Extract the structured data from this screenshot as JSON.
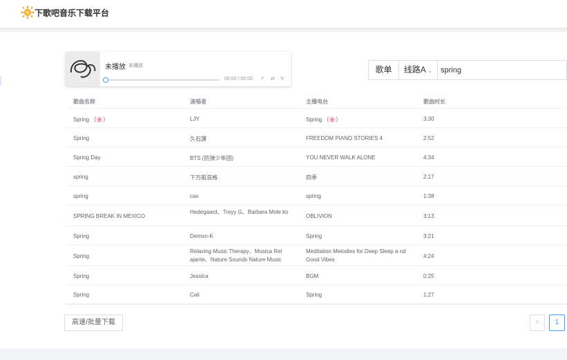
{
  "header": {
    "site_title": "下歌吧音乐下载平台",
    "logo_icon": "sun-logo-icon"
  },
  "player": {
    "title": "未播放",
    "artist": "未播放",
    "time": "00:00 / 00:00",
    "progress": 0,
    "controls": [
      "volume-icon",
      "shuffle-icon",
      "loop-icon"
    ]
  },
  "search": {
    "type_label": "歌单",
    "line_label": "线路A",
    "query": "spring"
  },
  "table": {
    "columns": [
      "歌曲名称",
      "演唱者",
      "主播电台",
      "歌曲时长"
    ],
    "rows": [
      [
        "Spring （🌸）",
        "LJY",
        "Spring （🌸）",
        "3:30"
      ],
      [
        "Spring",
        "久石譲",
        "FREEDOM PIANO STORIES 4",
        "2:52"
      ],
      [
        "Spring Day",
        "BTS (防弹少年团)",
        "YOU NEVER WALK ALONE",
        "4:34"
      ],
      [
        "spring",
        "下万般滋格",
        "四季",
        "2:17"
      ],
      [
        "spring",
        "cav",
        "spring",
        "1:38"
      ],
      [
        "SPRING BREAK IN MEXICO",
        "Hedegaard、Treyy G、Barbara Mole ko",
        "OBLIVION",
        "3:13"
      ],
      [
        "Spring",
        "Demon-K",
        "Spring",
        "3:21"
      ],
      [
        "Spring",
        "Relaxing Music Therapy、Musica Rel ajante、Nature Sounds Nature Music",
        "Meditation Melodies for Deep Sleep a nd Good Vibes",
        "4:24"
      ],
      [
        "Spring",
        "Jessica",
        "BGM",
        "0:25"
      ],
      [
        "Spring",
        "Cali",
        "Spring",
        "1:27"
      ]
    ]
  },
  "actions": {
    "batch_download": "高速/批量下载"
  },
  "pagination": {
    "prev": "<",
    "current": "1"
  },
  "colors": {
    "accent": "#409eff",
    "border": "#ebeef5",
    "text": "#606266"
  }
}
